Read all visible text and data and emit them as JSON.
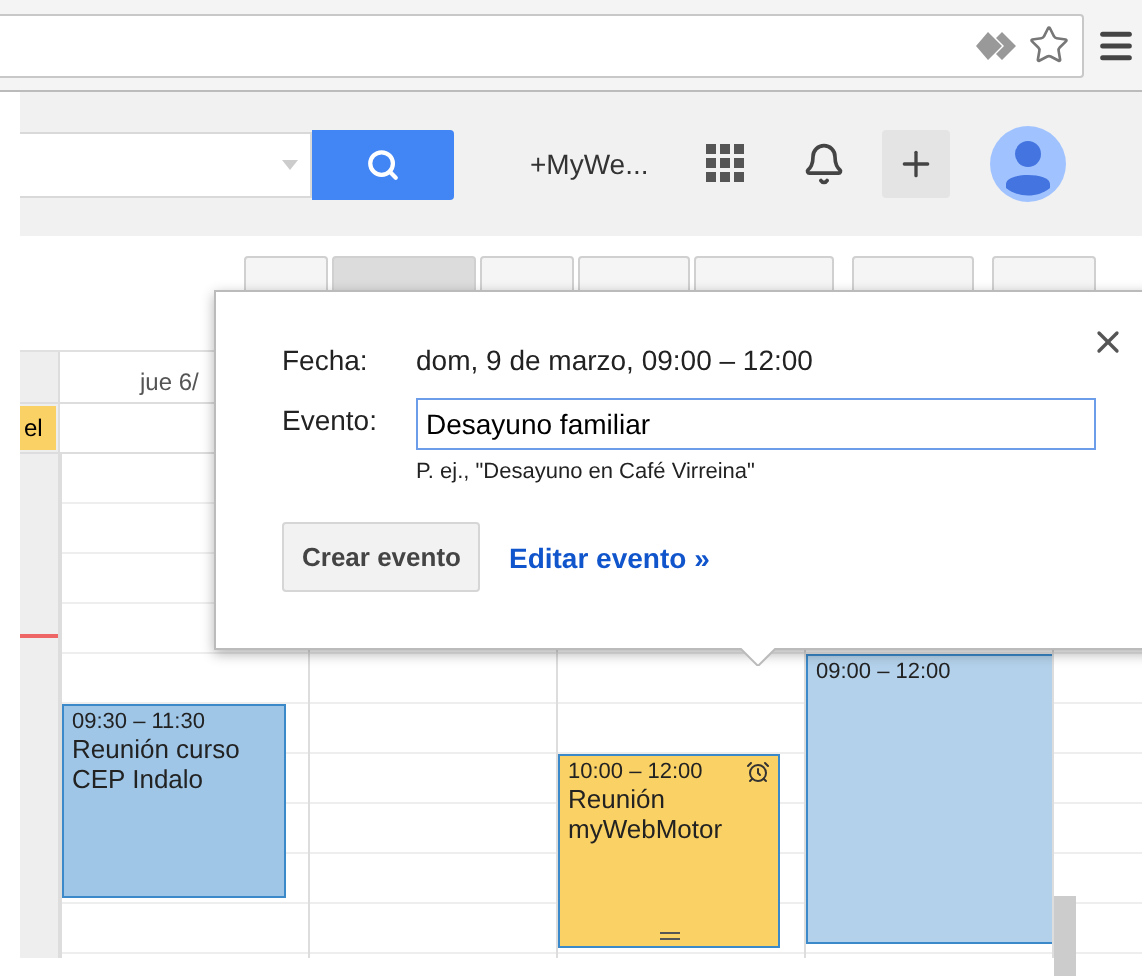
{
  "header": {
    "account_label": "+MyWe..."
  },
  "views": [
    {
      "selected": false
    },
    {
      "selected": true
    },
    {
      "selected": false
    },
    {
      "selected": false
    },
    {
      "selected": false
    }
  ],
  "calendar": {
    "day_header": "jue 6/",
    "all_day": [
      {
        "title": "el"
      }
    ],
    "columns": [
      {
        "events": [
          {
            "time": "09:30 – 11:30",
            "title": "Reunión curso CEP Indalo",
            "color": "#9fc6e7",
            "alarm": false
          }
        ]
      },
      {},
      {
        "events": [
          {
            "time": "10:00 – 12:00",
            "title": "Reunión myWebMotor",
            "color": "#fad165",
            "alarm": true
          }
        ]
      },
      {
        "events": [
          {
            "time": "09:00 – 12:00",
            "color": "#b3d1ea",
            "alarm": false
          }
        ]
      }
    ]
  },
  "popup": {
    "date_label": "Fecha:",
    "date_value": "dom, 9 de marzo, 09:00 – 12:00",
    "event_label": "Evento:",
    "event_value": "Desayuno familiar",
    "hint": "P. ej., \"Desayuno en Café Virreina\"",
    "create_button": "Crear evento",
    "edit_link": "Editar evento »"
  }
}
